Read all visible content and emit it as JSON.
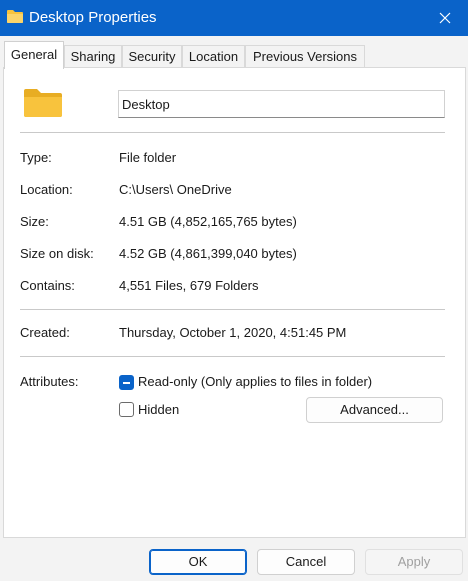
{
  "window": {
    "title": "Desktop Properties",
    "icon": "folder-icon",
    "close_icon": "close-icon"
  },
  "tabs": [
    {
      "label": "General",
      "active": true
    },
    {
      "label": "Sharing",
      "active": false
    },
    {
      "label": "Security",
      "active": false
    },
    {
      "label": "Location",
      "active": false
    },
    {
      "label": "Previous Versions",
      "active": false
    }
  ],
  "general": {
    "name_value": "Desktop",
    "rows": {
      "type": {
        "label": "Type:",
        "value": "File folder"
      },
      "location": {
        "label": "Location:",
        "value": "C:\\Users\\ OneDrive"
      },
      "size": {
        "label": "Size:",
        "value": "4.51 GB (4,852,165,765 bytes)"
      },
      "size_on_disk": {
        "label": "Size on disk:",
        "value": "4.52 GB (4,861,399,040 bytes)"
      },
      "contains": {
        "label": "Contains:",
        "value": "4,551 Files, 679 Folders"
      },
      "created": {
        "label": "Created:",
        "value": "Thursday, October 1, 2020, 4:51:45 PM"
      }
    },
    "attributes": {
      "label": "Attributes:",
      "readonly_label": "Read-only (Only applies to files in folder)",
      "readonly_state": "indeterminate",
      "hidden_label": "Hidden",
      "hidden_checked": false,
      "advanced_label": "Advanced..."
    }
  },
  "buttons": {
    "ok": "OK",
    "cancel": "Cancel",
    "apply": "Apply"
  },
  "colors": {
    "accent": "#0a63c9",
    "title_bar": "#0a63c9",
    "folder_yellow": "#f8c33d"
  }
}
